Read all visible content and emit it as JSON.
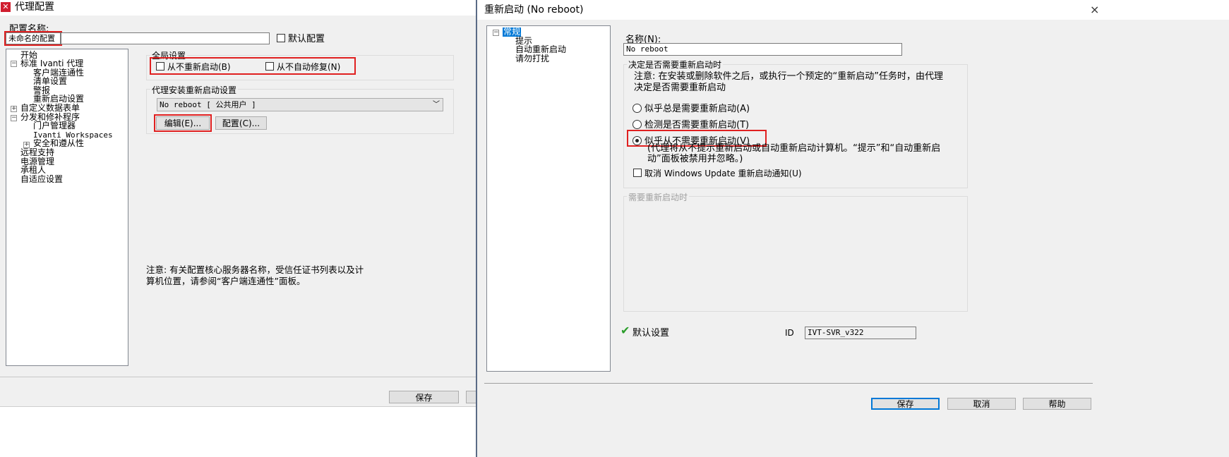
{
  "left_window": {
    "title": "代理配置",
    "config_name_label": "配置名称:",
    "config_name_value": "未命名的配置",
    "default_config_label": "默认配置",
    "tree": {
      "items": [
        {
          "label": "开始"
        },
        {
          "label": "标准 Ivanti 代理"
        },
        {
          "label": "客户端连通性"
        },
        {
          "label": "清单设置"
        },
        {
          "label": "警报"
        },
        {
          "label": "重新启动设置"
        },
        {
          "label": "自定义数据表单"
        },
        {
          "label": "分发和修补程序"
        },
        {
          "label": "门户管理器"
        },
        {
          "label": "Ivanti Workspaces"
        },
        {
          "label": "安全和遵从性"
        },
        {
          "label": "远程支持"
        },
        {
          "label": "电源管理"
        },
        {
          "label": "承租人"
        },
        {
          "label": "自适应设置"
        }
      ]
    },
    "global_settings": {
      "label": "全局设置",
      "never_reboot": "从不重新启动(B)",
      "never_repair": "从不自动修复(N)"
    },
    "agent_install_reboot": {
      "label": "代理安装重新启动设置",
      "selected": "No reboot  [ 公共用户 ]",
      "edit_button": "编辑(E)...",
      "config_button": "配置(C)..."
    },
    "note": "注意: 有关配置核心服务器名称，受信任证书列表以及计算机位置，请参阅“客户端连通性”面板。",
    "save_button": "保存"
  },
  "right_window": {
    "title": "重新启动 (No reboot)",
    "close_label": "×",
    "tree": {
      "items": [
        {
          "label": "常规"
        },
        {
          "label": "提示"
        },
        {
          "label": "自动重新启动"
        },
        {
          "label": "请勿打扰"
        }
      ]
    },
    "name_label": "名称(N):",
    "name_value": "No reboot",
    "decide_group": {
      "label": "决定是否需要重新启动时",
      "note": "注意: 在安装或删除软件之后，或执行一个预定的“重新启动”任务时，由代理决定是否需要重新启动",
      "option_always": "似乎总是需要重新启动(A)",
      "option_detect": "检测是否需要重新启动(T)",
      "option_never": "似乎从不需要重新启动(V)",
      "option_never_desc": "(代理将从不提示重新启动或自动重新启动计算机。“提示”和“自动重新启动”面板被禁用并忽略。)",
      "cancel_wu": "取消 Windows Update 重新启动通知(U)"
    },
    "needs_reboot_group": {
      "label": "需要重新启动时"
    },
    "default_setting_label": "默认设置",
    "id_label": "ID",
    "id_value": "IVT-SVR_v322",
    "save_button": "保存",
    "cancel_button": "取消",
    "help_button": "帮助"
  }
}
